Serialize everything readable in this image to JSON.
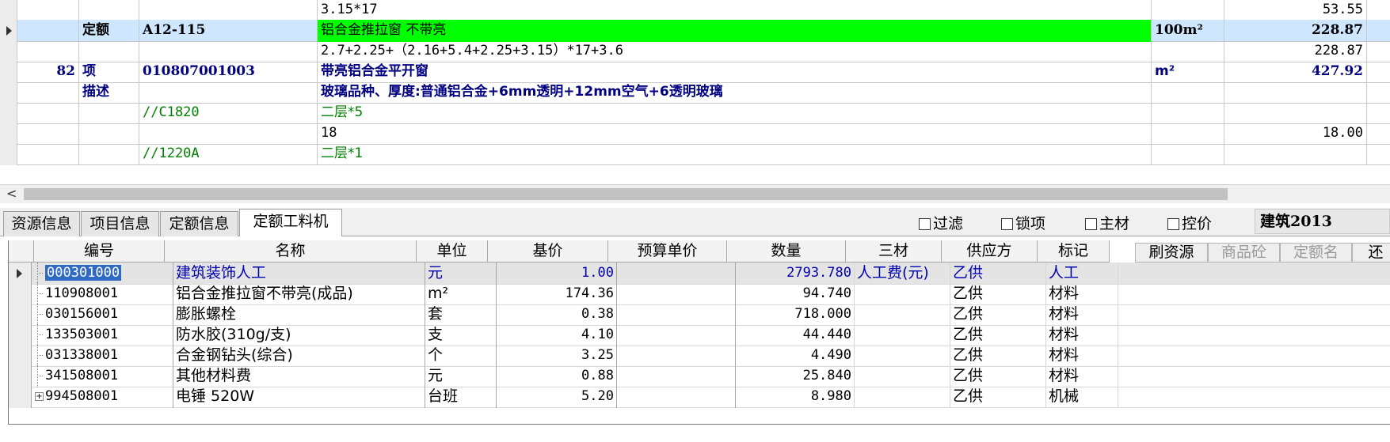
{
  "upper_rows": [
    {
      "num": "",
      "type": "",
      "code": "",
      "name": "3.15*17",
      "unit": "",
      "qty": "53.55",
      "style": "expr"
    },
    {
      "num": "",
      "type": "定额",
      "code": "A12-115",
      "name": "铝合金推拉窗 不带亮",
      "unit": "100m²",
      "qty": "228.87",
      "style": "quota"
    },
    {
      "num": "",
      "type": "",
      "code": "",
      "name": "2.7+2.25+（2.16+5.4+2.25+3.15）*17+3.6",
      "unit": "",
      "qty": "228.87",
      "style": "expr"
    },
    {
      "num": "82",
      "type": "项",
      "code": "010807001003",
      "name": "带亮铝合金平开窗",
      "unit": "m²",
      "qty": "427.92",
      "style": "item"
    },
    {
      "num": "",
      "type": "描述",
      "code": "",
      "name": "玻璃品种、厚度:普通铝合金+6mm透明+12mm空气+6透明玻璃",
      "unit": "",
      "qty": "",
      "style": "desc"
    },
    {
      "num": "",
      "type": "",
      "code": "//C1820",
      "name": "二层*5",
      "unit": "",
      "qty": "",
      "style": "comment"
    },
    {
      "num": "",
      "type": "",
      "code": "",
      "name": "18",
      "unit": "",
      "qty": "18.00",
      "style": "expr"
    },
    {
      "num": "",
      "type": "",
      "code": "//1220A",
      "name": "二层*1",
      "unit": "",
      "qty": "",
      "style": "comment"
    }
  ],
  "scroll_left_arrow": "<",
  "tabs": [
    "资源信息",
    "项目信息",
    "定额信息",
    "定额工料机"
  ],
  "checkboxes": [
    "过滤",
    "锁项",
    "主材",
    "控价"
  ],
  "standard_label": "建筑2013",
  "columns": [
    "编号",
    "名称",
    "单位",
    "基价",
    "预算单价",
    "数量",
    "三材",
    "供应方",
    "标记"
  ],
  "right_buttons": [
    {
      "label": "刷资源",
      "disabled": false
    },
    {
      "label": "商品砼",
      "disabled": true
    },
    {
      "label": "定额名",
      "disabled": true
    },
    {
      "label": "还",
      "disabled": false
    }
  ],
  "resources": [
    {
      "code": "000301000",
      "name": "建筑装饰人工",
      "unit": "元",
      "price": "1.00",
      "budget": "",
      "qty": "2793.780",
      "san": "人工费(元)",
      "supplier": "乙供",
      "mark": "人工"
    },
    {
      "code": "110908001",
      "name": "铝合金推拉窗不带亮(成品)",
      "unit": "m²",
      "price": "174.36",
      "budget": "",
      "qty": "94.740",
      "san": "",
      "supplier": "乙供",
      "mark": "材料"
    },
    {
      "code": "030156001",
      "name": "膨胀螺栓",
      "unit": "套",
      "price": "0.38",
      "budget": "",
      "qty": "718.000",
      "san": "",
      "supplier": "乙供",
      "mark": "材料"
    },
    {
      "code": "133503001",
      "name": "防水胶(310g/支)",
      "unit": "支",
      "price": "4.10",
      "budget": "",
      "qty": "44.440",
      "san": "",
      "supplier": "乙供",
      "mark": "材料"
    },
    {
      "code": "031338001",
      "name": "合金钢钻头(综合)",
      "unit": "个",
      "price": "3.25",
      "budget": "",
      "qty": "4.490",
      "san": "",
      "supplier": "乙供",
      "mark": "材料"
    },
    {
      "code": "341508001",
      "name": "其他材料费",
      "unit": "元",
      "price": "0.88",
      "budget": "",
      "qty": "25.840",
      "san": "",
      "supplier": "乙供",
      "mark": "材料"
    },
    {
      "code": "994508001",
      "name": "电锤 520W",
      "unit": "台班",
      "price": "5.20",
      "budget": "",
      "qty": "8.980",
      "san": "",
      "supplier": "乙供",
      "mark": "机械"
    }
  ],
  "colors": {
    "quota_highlight": "#00ff00",
    "selected_row": "#cfe6ff",
    "item_text": "#000080",
    "comment_text": "#008000"
  }
}
